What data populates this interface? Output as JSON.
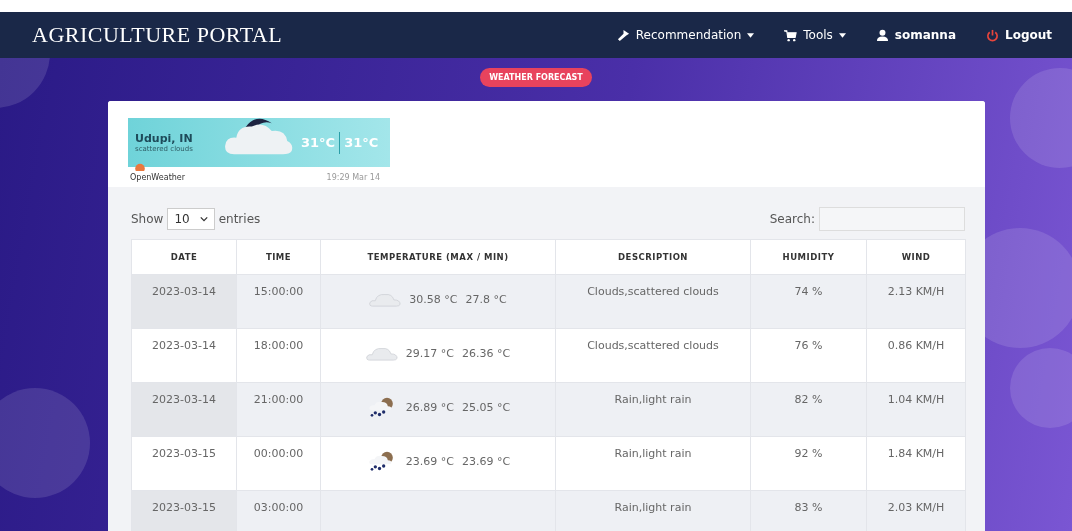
{
  "navbar": {
    "brand": "AGRICULTURE PORTAL",
    "items": [
      {
        "label": "Recommendation",
        "kind": "hammer",
        "dropdown": true
      },
      {
        "label": "Tools",
        "kind": "cart",
        "dropdown": true
      },
      {
        "label": "somanna",
        "kind": "user",
        "dropdown": false
      },
      {
        "label": "Logout",
        "kind": "power",
        "dropdown": false
      }
    ]
  },
  "page_badge": "WEATHER FORECAST",
  "widget": {
    "city": "Udupi, IN",
    "description": "scattered clouds",
    "temp_1": "31°C",
    "temp_2": "31°C",
    "provider": "OpenWeather",
    "updated": "19:29 Mar 14"
  },
  "table_controls": {
    "show_label": "Show",
    "page_size": "10",
    "entries_label": "entries",
    "search_label": "Search:"
  },
  "table": {
    "columns": [
      "DATE",
      "TIME",
      "TEMPERATURE (MAX / MIN)",
      "DESCRIPTION",
      "HUMIDITY",
      "WIND"
    ],
    "rows": [
      {
        "date": "2023-03-14",
        "time": "15:00:00",
        "kind": "clouds",
        "max": "30.58 °C",
        "min": "27.8 °C",
        "description": "Clouds,scattered clouds",
        "humidity": "74 %",
        "wind": "2.13 KM/H"
      },
      {
        "date": "2023-03-14",
        "time": "18:00:00",
        "kind": "clouds",
        "max": "29.17 °C",
        "min": "26.36 °C",
        "description": "Clouds,scattered clouds",
        "humidity": "76 %",
        "wind": "0.86 KM/H"
      },
      {
        "date": "2023-03-14",
        "time": "21:00:00",
        "kind": "rain",
        "max": "26.89 °C",
        "min": "25.05 °C",
        "description": "Rain,light rain",
        "humidity": "82 %",
        "wind": "1.04 KM/H"
      },
      {
        "date": "2023-03-15",
        "time": "00:00:00",
        "kind": "rain",
        "max": "23.69 °C",
        "min": "23.69 °C",
        "description": "Rain,light rain",
        "humidity": "92 %",
        "wind": "1.84 KM/H"
      },
      {
        "date": "2023-03-15",
        "time": "03:00:00",
        "description": "Rain,light rain",
        "humidity": "83 %",
        "wind": "2.03 KM/H"
      }
    ]
  }
}
